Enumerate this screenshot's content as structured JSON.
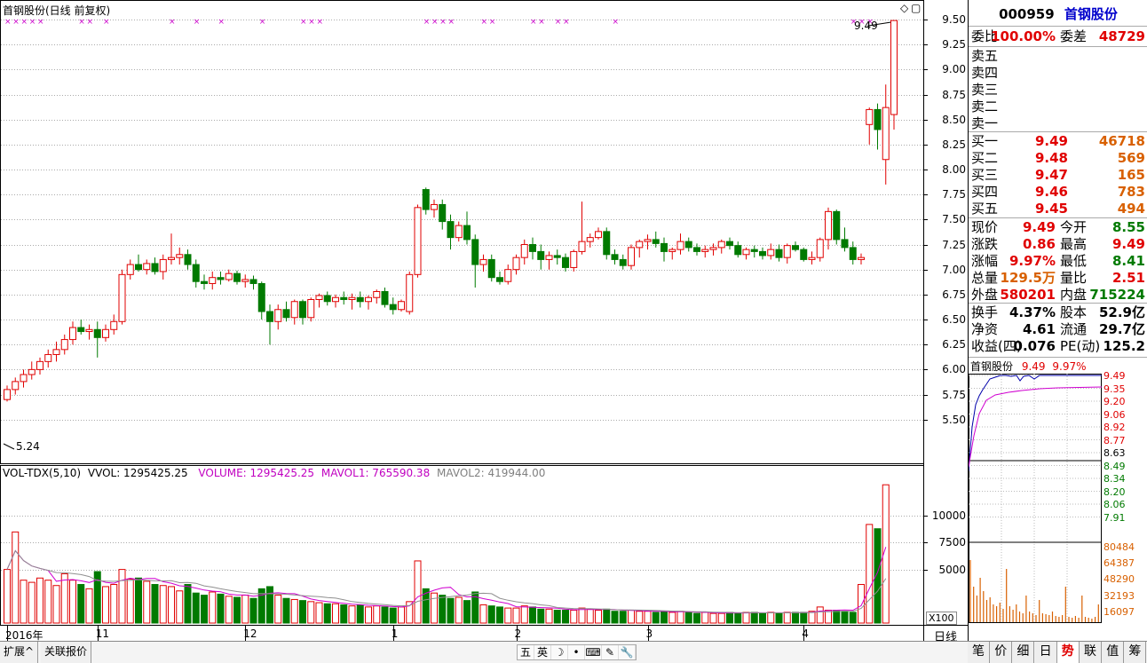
{
  "chart_title": "首钢股份(日线 前复权)",
  "price_axis": [
    "9.50",
    "9.25",
    "9.00",
    "8.75",
    "8.50",
    "8.25",
    "8.00",
    "7.75",
    "7.50",
    "7.25",
    "7.00",
    "6.75",
    "6.50",
    "6.25",
    "6.00",
    "5.75",
    "5.50"
  ],
  "high_marker": "9.49",
  "low_marker": "5.24",
  "vol_legend": {
    "indicator": "VOL-TDX(5,10)",
    "vvol": "VVOL: 1295425.25",
    "volume": "VOLUME: 1295425.25",
    "mavol1": "MAVOL1: 765590.38",
    "mavol2": "MAVOL2: 419944.00"
  },
  "vol_axis": [
    "10000",
    "7500",
    "5000"
  ],
  "vol_unit": "X100",
  "date_axis": {
    "labels": [
      {
        "text": "2016年",
        "index": 0
      },
      {
        "text": "11",
        "index": 11
      },
      {
        "text": "12",
        "index": 29
      },
      {
        "text": "1",
        "index": 47
      },
      {
        "text": "2",
        "index": 62
      },
      {
        "text": "3",
        "index": 78
      },
      {
        "text": "4",
        "index": 97
      }
    ],
    "period": "日线"
  },
  "colors": {
    "up": "#e00000",
    "down": "#007a00",
    "grid": "#aaaaaa",
    "ma1": "#d000d0",
    "ma2": "#909090",
    "markers": "#cc00cc"
  },
  "chart_data": {
    "type": "candlestick",
    "ylim": [
      5.24,
      9.5
    ],
    "vol_ylim": [
      0,
      13000
    ],
    "ohlc": [
      [
        5.7,
        5.84,
        5.68,
        5.8
      ],
      [
        5.8,
        5.92,
        5.75,
        5.88
      ],
      [
        5.88,
        6.0,
        5.82,
        5.95
      ],
      [
        5.95,
        6.08,
        5.9,
        6.0
      ],
      [
        6.0,
        6.12,
        5.95,
        6.08
      ],
      [
        6.08,
        6.2,
        6.02,
        6.15
      ],
      [
        6.15,
        6.28,
        6.08,
        6.2
      ],
      [
        6.2,
        6.35,
        6.15,
        6.3
      ],
      [
        6.3,
        6.48,
        6.25,
        6.42
      ],
      [
        6.42,
        6.5,
        6.35,
        6.38
      ],
      [
        6.38,
        6.45,
        6.3,
        6.4
      ],
      [
        6.4,
        6.48,
        6.12,
        6.32
      ],
      [
        6.32,
        6.45,
        6.28,
        6.4
      ],
      [
        6.4,
        6.55,
        6.35,
        6.48
      ],
      [
        6.48,
        7.0,
        6.45,
        6.95
      ],
      [
        6.95,
        7.1,
        6.9,
        7.05
      ],
      [
        7.05,
        7.15,
        6.98,
        7.0
      ],
      [
        7.0,
        7.1,
        6.95,
        7.06
      ],
      [
        7.06,
        7.12,
        6.95,
        6.98
      ],
      [
        6.98,
        7.15,
        6.9,
        7.1
      ],
      [
        7.1,
        7.36,
        7.05,
        7.12
      ],
      [
        7.12,
        7.22,
        7.05,
        7.15
      ],
      [
        7.15,
        7.2,
        7.0,
        7.05
      ],
      [
        7.05,
        7.1,
        6.82,
        6.88
      ],
      [
        6.88,
        6.95,
        6.8,
        6.86
      ],
      [
        6.86,
        6.98,
        6.8,
        6.92
      ],
      [
        6.92,
        6.98,
        6.85,
        6.9
      ],
      [
        6.9,
        7.0,
        6.88,
        6.96
      ],
      [
        6.96,
        6.99,
        6.85,
        6.88
      ],
      [
        6.88,
        6.95,
        6.82,
        6.9
      ],
      [
        6.9,
        6.94,
        6.8,
        6.86
      ],
      [
        6.86,
        6.88,
        6.5,
        6.58
      ],
      [
        6.58,
        6.65,
        6.25,
        6.48
      ],
      [
        6.48,
        6.65,
        6.4,
        6.6
      ],
      [
        6.6,
        6.68,
        6.48,
        6.52
      ],
      [
        6.52,
        6.7,
        6.45,
        6.68
      ],
      [
        6.68,
        6.7,
        6.45,
        6.52
      ],
      [
        6.52,
        6.72,
        6.48,
        6.7
      ],
      [
        6.7,
        6.76,
        6.62,
        6.74
      ],
      [
        6.74,
        6.78,
        6.64,
        6.68
      ],
      [
        6.68,
        6.75,
        6.62,
        6.72
      ],
      [
        6.72,
        6.78,
        6.65,
        6.7
      ],
      [
        6.7,
        6.76,
        6.6,
        6.72
      ],
      [
        6.72,
        6.78,
        6.62,
        6.68
      ],
      [
        6.68,
        6.74,
        6.6,
        6.72
      ],
      [
        6.72,
        6.8,
        6.66,
        6.78
      ],
      [
        6.78,
        6.82,
        6.62,
        6.65
      ],
      [
        6.65,
        6.72,
        6.55,
        6.6
      ],
      [
        6.6,
        6.7,
        6.58,
        6.68
      ],
      [
        6.58,
        6.98,
        6.55,
        6.95
      ],
      [
        6.95,
        7.65,
        6.92,
        7.62
      ],
      [
        7.8,
        7.82,
        7.55,
        7.6
      ],
      [
        7.6,
        7.7,
        7.52,
        7.65
      ],
      [
        7.65,
        7.7,
        7.4,
        7.48
      ],
      [
        7.48,
        7.55,
        7.2,
        7.32
      ],
      [
        7.32,
        7.48,
        7.28,
        7.44
      ],
      [
        7.44,
        7.58,
        7.25,
        7.3
      ],
      [
        7.3,
        7.35,
        6.82,
        7.05
      ],
      [
        7.05,
        7.15,
        6.98,
        7.1
      ],
      [
        7.1,
        7.15,
        6.88,
        6.92
      ],
      [
        6.92,
        6.98,
        6.85,
        6.88
      ],
      [
        6.88,
        7.05,
        6.85,
        7.0
      ],
      [
        7.0,
        7.15,
        6.95,
        7.12
      ],
      [
        7.12,
        7.3,
        7.05,
        7.25
      ],
      [
        7.25,
        7.32,
        7.1,
        7.18
      ],
      [
        7.18,
        7.25,
        7.0,
        7.1
      ],
      [
        7.1,
        7.18,
        7.0,
        7.14
      ],
      [
        7.14,
        7.2,
        7.05,
        7.12
      ],
      [
        7.12,
        7.16,
        6.98,
        7.02
      ],
      [
        7.02,
        7.2,
        6.98,
        7.18
      ],
      [
        7.18,
        7.68,
        7.15,
        7.28
      ],
      [
        7.28,
        7.36,
        7.22,
        7.32
      ],
      [
        7.32,
        7.42,
        7.3,
        7.38
      ],
      [
        7.38,
        7.42,
        7.1,
        7.15
      ],
      [
        7.15,
        7.2,
        7.05,
        7.1
      ],
      [
        7.1,
        7.15,
        7.0,
        7.04
      ],
      [
        7.04,
        7.25,
        7.0,
        7.22
      ],
      [
        7.22,
        7.3,
        7.12,
        7.28
      ],
      [
        7.28,
        7.35,
        7.2,
        7.3
      ],
      [
        7.3,
        7.38,
        7.22,
        7.26
      ],
      [
        7.26,
        7.32,
        7.08,
        7.18
      ],
      [
        7.18,
        7.22,
        7.1,
        7.2
      ],
      [
        7.2,
        7.36,
        7.15,
        7.28
      ],
      [
        7.28,
        7.32,
        7.18,
        7.22
      ],
      [
        7.22,
        7.26,
        7.14,
        7.18
      ],
      [
        7.18,
        7.24,
        7.12,
        7.2
      ],
      [
        7.2,
        7.26,
        7.14,
        7.22
      ],
      [
        7.22,
        7.3,
        7.16,
        7.28
      ],
      [
        7.28,
        7.32,
        7.2,
        7.24
      ],
      [
        7.24,
        7.28,
        7.12,
        7.15
      ],
      [
        7.15,
        7.22,
        7.1,
        7.2
      ],
      [
        7.2,
        7.24,
        7.12,
        7.18
      ],
      [
        7.18,
        7.22,
        7.1,
        7.14
      ],
      [
        7.14,
        7.26,
        7.1,
        7.2
      ],
      [
        7.2,
        7.25,
        7.08,
        7.12
      ],
      [
        7.12,
        7.26,
        7.06,
        7.24
      ],
      [
        7.24,
        7.28,
        7.18,
        7.2
      ],
      [
        7.2,
        7.22,
        7.08,
        7.1
      ],
      [
        7.1,
        7.18,
        7.05,
        7.12
      ],
      [
        7.12,
        7.32,
        7.08,
        7.3
      ],
      [
        7.3,
        7.62,
        7.2,
        7.58
      ],
      [
        7.58,
        7.6,
        7.25,
        7.3
      ],
      [
        7.3,
        7.42,
        7.18,
        7.22
      ],
      [
        7.22,
        7.28,
        7.05,
        7.1
      ],
      [
        7.1,
        7.16,
        7.05,
        7.12
      ],
      [
        8.45,
        8.62,
        8.25,
        8.6
      ],
      [
        8.6,
        8.66,
        8.2,
        8.4
      ],
      [
        8.1,
        8.85,
        7.85,
        8.62
      ],
      [
        8.55,
        9.49,
        8.4,
        9.49
      ]
    ],
    "volume": [
      5000,
      8500,
      4000,
      3800,
      4200,
      4000,
      3500,
      4600,
      4000,
      3600,
      3200,
      4800,
      3400,
      3600,
      5000,
      4100,
      4200,
      3900,
      3600,
      3500,
      3400,
      3000,
      3600,
      2800,
      2600,
      2900,
      2700,
      2500,
      2400,
      2600,
      2300,
      3200,
      3400,
      2600,
      2300,
      2200,
      2100,
      2000,
      1900,
      1800,
      1800,
      1700,
      1600,
      1700,
      1500,
      1600,
      1500,
      1400,
      1500,
      2000,
      5800,
      3200,
      2800,
      2600,
      2300,
      2400,
      2100,
      2900,
      1700,
      1600,
      1500,
      1400,
      1400,
      1600,
      1500,
      1300,
      1300,
      1200,
      1200,
      1200,
      1400,
      1300,
      1200,
      1300,
      1100,
      1100,
      1200,
      1100,
      1100,
      1000,
      1100,
      1000,
      1100,
      1000,
      900,
      1000,
      900,
      900,
      1000,
      900,
      1000,
      1000,
      900,
      1000,
      900,
      1000,
      1000,
      1000,
      1100,
      1500,
      1200,
      1200,
      1100,
      1000,
      3600,
      9200,
      8800,
      12900
    ]
  },
  "panel": {
    "code": "000959",
    "name": "首钢股份",
    "weibi_label": "委比",
    "weibi": "100.00%",
    "weicha_label": "委差",
    "weicha": "48729",
    "sells": [
      {
        "label": "卖五"
      },
      {
        "label": "卖四"
      },
      {
        "label": "卖三"
      },
      {
        "label": "卖二"
      },
      {
        "label": "卖一"
      }
    ],
    "buys": [
      {
        "label": "买一",
        "price": "9.49",
        "vol": "46718"
      },
      {
        "label": "买二",
        "price": "9.48",
        "vol": "569"
      },
      {
        "label": "买三",
        "price": "9.47",
        "vol": "165"
      },
      {
        "label": "买四",
        "price": "9.46",
        "vol": "783"
      },
      {
        "label": "买五",
        "price": "9.45",
        "vol": "494"
      }
    ],
    "quote": [
      {
        "l1": "现价",
        "v1": "9.49",
        "c1": "red",
        "l2": "今开",
        "v2": "8.55",
        "c2": "grn"
      },
      {
        "l1": "涨跌",
        "v1": "0.86",
        "c1": "red",
        "l2": "最高",
        "v2": "9.49",
        "c2": "red"
      },
      {
        "l1": "涨幅",
        "v1": "9.97%",
        "c1": "red",
        "l2": "最低",
        "v2": "8.41",
        "c2": "grn"
      },
      {
        "l1": "总量",
        "v1": "129.5万",
        "c1": "org",
        "l2": "量比",
        "v2": "2.51",
        "c2": "red"
      },
      {
        "l1": "外盘",
        "v1": "580201",
        "c1": "red",
        "l2": "内盘",
        "v2": "715224",
        "c2": "grn"
      }
    ],
    "fund": [
      {
        "l1": "换手",
        "v1": "4.37%",
        "l2": "股本",
        "v2": "52.9亿"
      },
      {
        "l1": "净资",
        "v1": "4.61",
        "l2": "流通",
        "v2": "29.7亿"
      },
      {
        "l1": "收益(四)",
        "v1": "0.076",
        "l2": "PE(动)",
        "v2": "125.2"
      }
    ],
    "mini": {
      "name": "首钢股份",
      "price": "9.49",
      "pct": "9.97%",
      "price_labels": [
        "9.49",
        "9.35",
        "9.20",
        "9.06",
        "8.92",
        "8.77",
        "8.63",
        "8.49",
        "8.34",
        "8.20",
        "8.06",
        "7.91"
      ],
      "vol_labels": [
        "80484",
        "64387",
        "48290",
        "32193",
        "16097"
      ]
    }
  },
  "bottom": {
    "tabs": [
      "扩展^",
      "关联报价"
    ],
    "tools": [
      "五",
      "英",
      "☽",
      "•",
      "⌨",
      "✎",
      "🔧"
    ],
    "right_tabs": [
      "笔",
      "价",
      "细",
      "日",
      "势",
      "联",
      "值",
      "筹"
    ],
    "active_tab": "势"
  }
}
